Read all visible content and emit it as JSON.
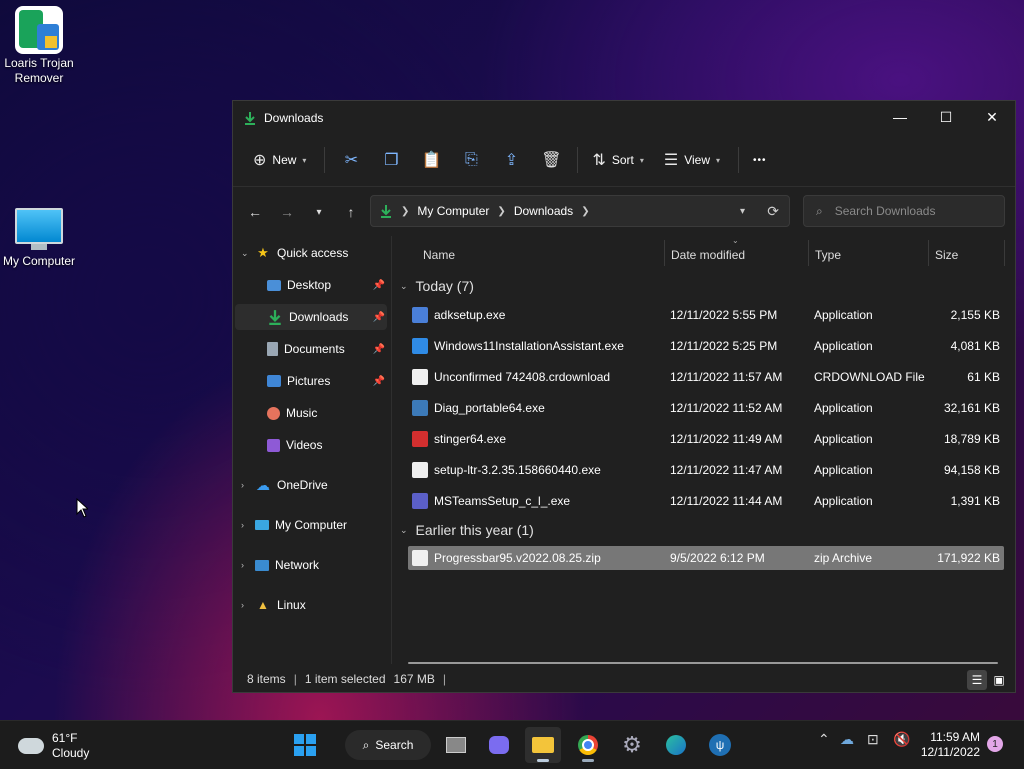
{
  "desktop": {
    "icons": [
      {
        "label": "Loaris Trojan Remover"
      },
      {
        "label": "My Computer"
      }
    ]
  },
  "window": {
    "title": "Downloads",
    "controls": {
      "minimize": "—",
      "maximize": "☐",
      "close": "✕"
    }
  },
  "toolbar": {
    "new_label": "New",
    "sort_label": "Sort",
    "view_label": "View",
    "more_label": "•••"
  },
  "address": {
    "crumbs": [
      "My Computer",
      "Downloads"
    ]
  },
  "search": {
    "placeholder": "Search Downloads"
  },
  "sidebar": {
    "quick_access": "Quick access",
    "items": [
      {
        "label": "Desktop"
      },
      {
        "label": "Downloads"
      },
      {
        "label": "Documents"
      },
      {
        "label": "Pictures"
      },
      {
        "label": "Music"
      },
      {
        "label": "Videos"
      }
    ],
    "roots": [
      {
        "label": "OneDrive"
      },
      {
        "label": "My Computer"
      },
      {
        "label": "Network"
      },
      {
        "label": "Linux"
      }
    ]
  },
  "columns": {
    "name": "Name",
    "date": "Date modified",
    "type": "Type",
    "size": "Size"
  },
  "groups": {
    "today": "Today (7)",
    "earlier": "Earlier this year (1)"
  },
  "files_today": [
    {
      "name": "adksetup.exe",
      "date": "12/11/2022 5:55 PM",
      "type": "Application",
      "size": "2,155 KB",
      "icon": "#4a7fd8"
    },
    {
      "name": "Windows11InstallationAssistant.exe",
      "date": "12/11/2022 5:25 PM",
      "type": "Application",
      "size": "4,081 KB",
      "icon": "#2f8be6"
    },
    {
      "name": "Unconfirmed 742408.crdownload",
      "date": "12/11/2022 11:57 AM",
      "type": "CRDOWNLOAD File",
      "size": "61 KB",
      "icon": "#f0f0f0"
    },
    {
      "name": "Diag_portable64.exe",
      "date": "12/11/2022 11:52 AM",
      "type": "Application",
      "size": "32,161 KB",
      "icon": "#3c7ab8"
    },
    {
      "name": "stinger64.exe",
      "date": "12/11/2022 11:49 AM",
      "type": "Application",
      "size": "18,789 KB",
      "icon": "#d32f2f"
    },
    {
      "name": "setup-ltr-3.2.35.158660440.exe",
      "date": "12/11/2022 11:47 AM",
      "type": "Application",
      "size": "94,158 KB",
      "icon": "#eeeeee"
    },
    {
      "name": "MSTeamsSetup_c_l_.exe",
      "date": "12/11/2022 11:44 AM",
      "type": "Application",
      "size": "1,391 KB",
      "icon": "#5b5fc7"
    }
  ],
  "files_earlier": [
    {
      "name": "Progressbar95.v2022.08.25.zip",
      "date": "9/5/2022 6:12 PM",
      "type": "zip Archive",
      "size": "171,922 KB",
      "icon": "#f0f0f0"
    }
  ],
  "status": {
    "items": "8 items",
    "selected": "1 item selected",
    "size": "167 MB"
  },
  "taskbar": {
    "temp": "61°F",
    "condition": "Cloudy",
    "search_label": "Search",
    "time": "11:59 AM",
    "date": "12/11/2022",
    "notifications": "1"
  },
  "colors": {
    "accent": "#2db05a",
    "window_bg": "#202020",
    "selection": "#777777"
  }
}
